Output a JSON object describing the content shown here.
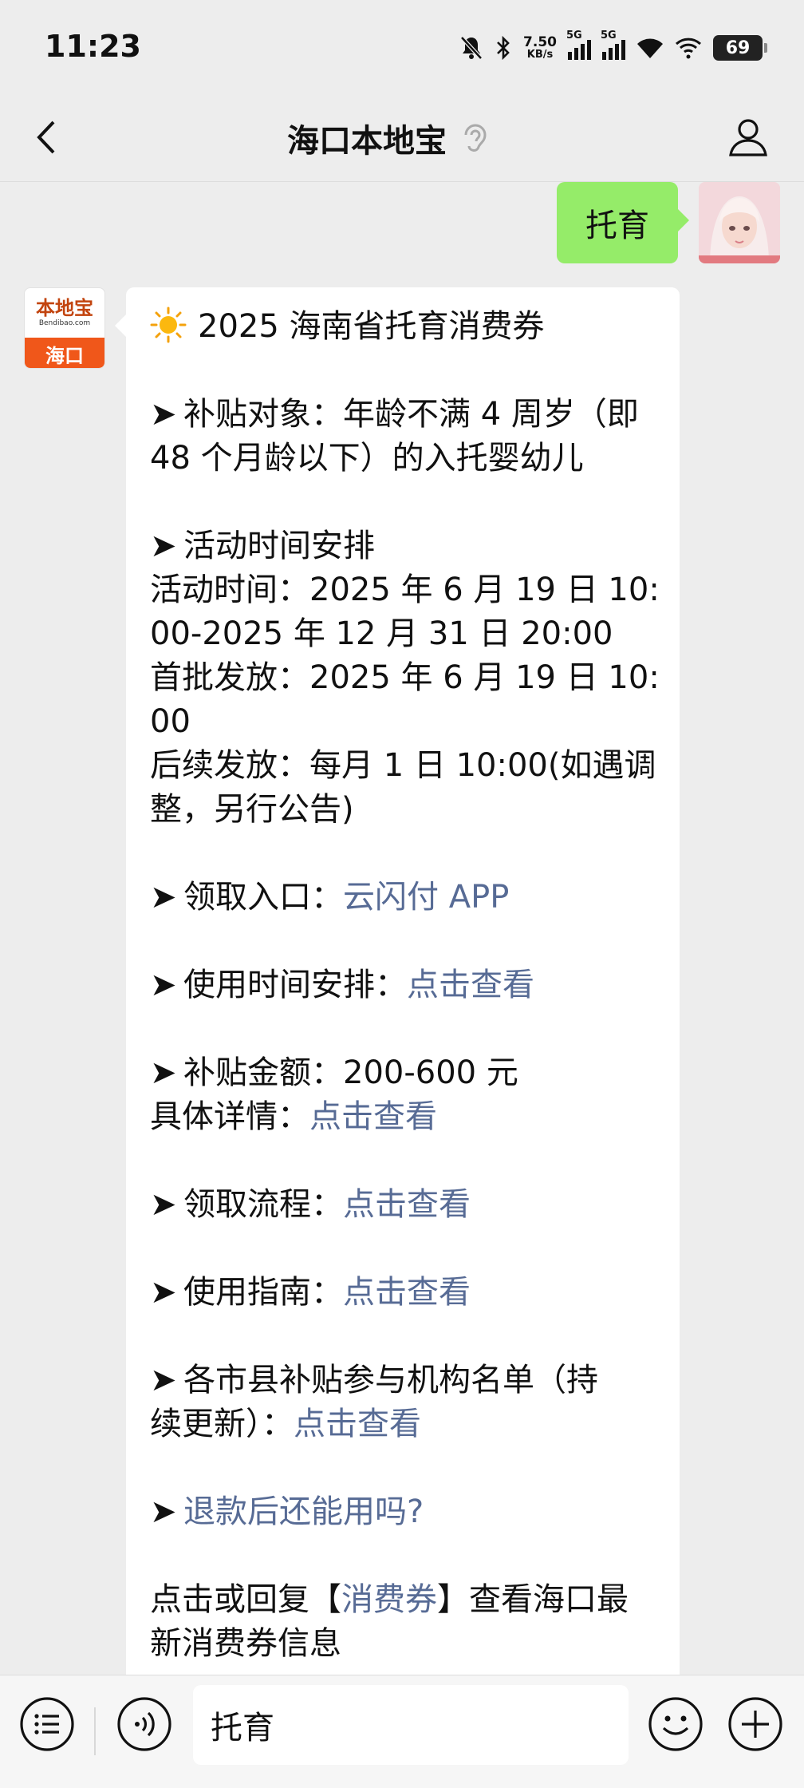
{
  "status_bar": {
    "time": "11:23",
    "net_speed_value": "7.50",
    "net_speed_unit": "KB/s",
    "sim1_label": "5G",
    "sim2_label": "5G",
    "battery": "69"
  },
  "header": {
    "title": "海口本地宝"
  },
  "messages": {
    "user_text": "托育",
    "bot_logo_main": "本地宝",
    "bot_logo_sub": "Bendibao.com",
    "bot_logo_city": "海口",
    "bot": {
      "title": "2025 海南省托育消费券",
      "arrow": "➤",
      "l1": "补贴对象：年龄不满 4 周岁（即",
      "l2": "48 个月龄以下）的入托婴幼儿",
      "l3": "活动时间安排",
      "l4": "活动时间：2025 年 6 月 19 日 10:",
      "l5": "00-2025 年 12 月 31 日 20:00",
      "l6": "首批发放：2025 年 6 月 19 日 10:",
      "l7": "00",
      "l8": "后续发放：每月 1 日 10:00(如遇调",
      "l9": "整，另行公告)",
      "receive_label": "领取入口：",
      "receive_link": "云闪付 APP",
      "usetime_label": "使用时间安排：",
      "usetime_link": "点击查看",
      "amount_label": "补贴金额：200-600 元",
      "detail_label": "具体详情：",
      "detail_link": "点击查看",
      "process_label": "领取流程：",
      "process_link": "点击查看",
      "guide_label": "使用指南：",
      "guide_link": "点击查看",
      "list_label1": "各市县补贴参与机构名单（持",
      "list_label2": "续更新）：",
      "list_link": "点击查看",
      "refund_link": "退款后还能用吗?",
      "footer1_a": "点击或回复【",
      "footer1_link": "消费券",
      "footer1_b": "】查看海口最",
      "footer2": "新消费券信息"
    }
  },
  "input": {
    "value": "托育"
  }
}
